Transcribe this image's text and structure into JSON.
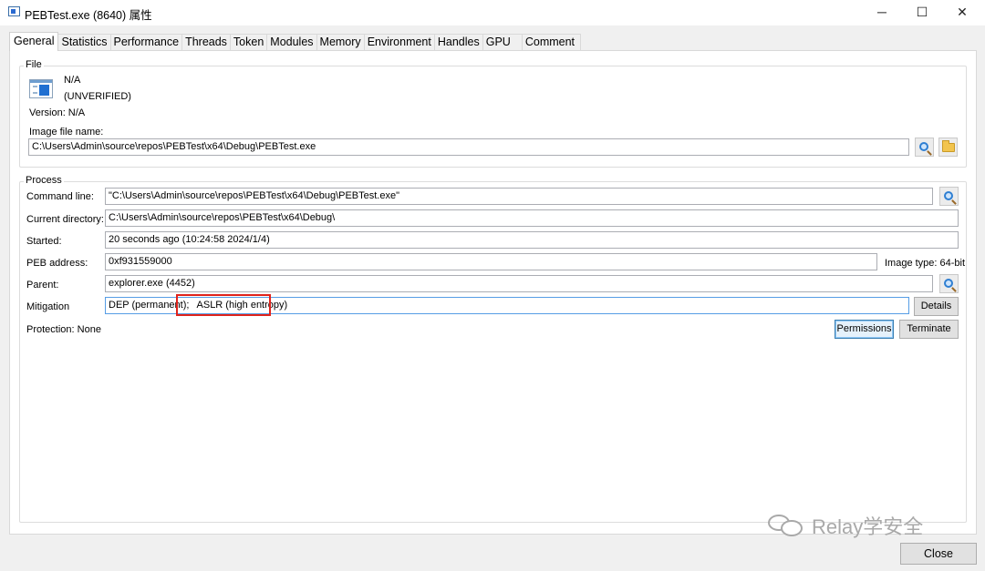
{
  "window": {
    "title": "PEBTest.exe (8640) 属性",
    "minimize": "─",
    "maximize": "☐",
    "close": "✕"
  },
  "tabs": [
    {
      "label": "General",
      "active": true
    },
    {
      "label": "Statistics"
    },
    {
      "label": "Performance"
    },
    {
      "label": "Threads"
    },
    {
      "label": "Token"
    },
    {
      "label": "Modules"
    },
    {
      "label": "Memory"
    },
    {
      "label": "Environment"
    },
    {
      "label": "Handles"
    },
    {
      "label": "GPU"
    },
    {
      "label": "Comment"
    }
  ],
  "file": {
    "group_title": "File",
    "description": "N/A",
    "company": "(UNVERIFIED)",
    "version_label": "Version: N/A",
    "image_file_label": "Image file name:",
    "image_file_value": "C:\\Users\\Admin\\source\\repos\\PEBTest\\x64\\Debug\\PEBTest.exe"
  },
  "process": {
    "group_title": "Process",
    "command_line_label": "Command line:",
    "command_line_value": "\"C:\\Users\\Admin\\source\\repos\\PEBTest\\x64\\Debug\\PEBTest.exe\"",
    "current_dir_label": "Current directory:",
    "current_dir_value": "C:\\Users\\Admin\\source\\repos\\PEBTest\\x64\\Debug\\",
    "started_label": "Started:",
    "started_value": "20 seconds ago (10:24:58 2024/1/4)",
    "peb_label": "PEB address:",
    "peb_value": "0xf931559000",
    "image_type": "Image type: 64-bit",
    "parent_label": "Parent:",
    "parent_value": "explorer.exe (4452)",
    "mitigation_label": "Mitigation",
    "mitigation_dep": "DEP (permanent);",
    "mitigation_aslr": "ASLR (high entropy)",
    "details_button": "Details",
    "protection": "Protection: None",
    "permissions_button": "Permissions",
    "terminate_button": "Terminate"
  },
  "watermark": "Relay学安全",
  "close_button": "Close",
  "colors": {
    "highlight_box": "#e0231c",
    "focus_border": "#569de5"
  }
}
